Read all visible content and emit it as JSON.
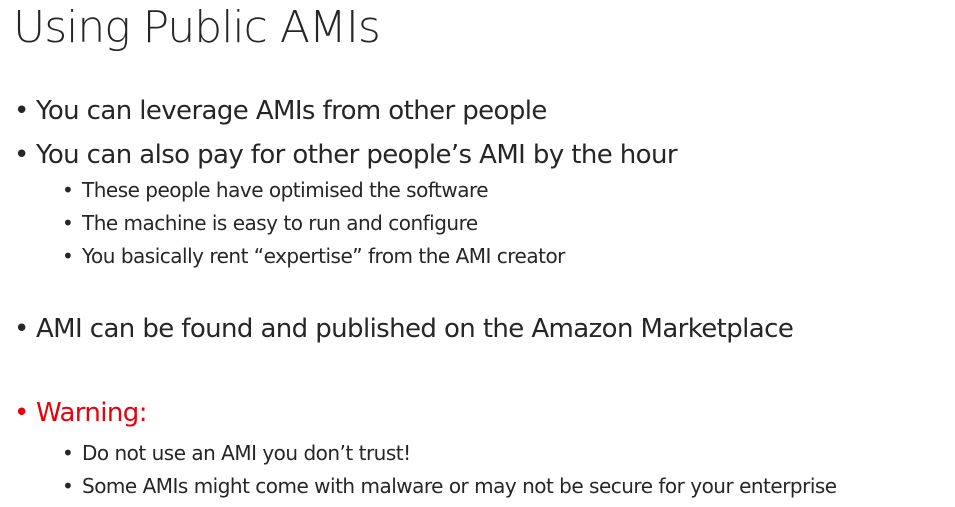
{
  "slide": {
    "title": "Using Public AMIs",
    "bullet_glyph": "•",
    "accent_color": "#e8000b",
    "text_color": "#262626",
    "bullets": [
      {
        "level": 1,
        "text": "You can leverage AMIs from other people"
      },
      {
        "level": 1,
        "text": "You can also pay for other people’s AMI by the hour"
      },
      {
        "level": 2,
        "text": "These people have optimised the software"
      },
      {
        "level": 2,
        "text": "The machine is easy to run and configure"
      },
      {
        "level": 2,
        "text": "You basically rent “expertise” from the AMI creator"
      },
      {
        "level": 1,
        "text": "AMI can be found and published on the Amazon Marketplace"
      },
      {
        "level": 1,
        "text": "Warning:",
        "style": "warning"
      },
      {
        "level": 2,
        "text": "Do not use an AMI you don’t trust!"
      },
      {
        "level": 2,
        "text": "Some AMIs might come with malware or may not be secure for your enterprise"
      }
    ]
  }
}
